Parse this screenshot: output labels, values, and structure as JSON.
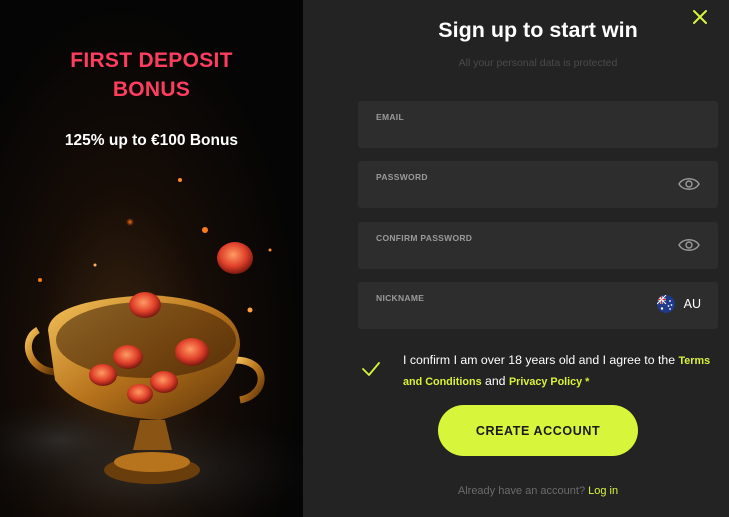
{
  "promo": {
    "title_line1": "FIRST DEPOSIT",
    "title_line2": "BONUS",
    "subtitle": "125% up to €100 Bonus"
  },
  "form": {
    "title": "Sign up to start win",
    "subtitle": "All your personal data is protected",
    "fields": {
      "email": {
        "label": "EMAIL",
        "value": ""
      },
      "password": {
        "label": "PASSWORD",
        "value": ""
      },
      "confirm_password": {
        "label": "CONFIRM PASSWORD",
        "value": ""
      },
      "nickname": {
        "label": "NICKNAME",
        "value": "",
        "country_code": "AU"
      }
    },
    "consent": {
      "text_prefix": "I confirm I am over 18 years old and I agree to the",
      "terms_link": "Terms and Conditions",
      "and": "and",
      "privacy_link": "Privacy Policy *",
      "checked": true
    },
    "submit_label": "CREATE ACCOUNT",
    "login_prompt": "Already have an account?",
    "login_link": "Log in"
  },
  "colors": {
    "accent": "#d7f53a",
    "promo_title": "#ff3d5e",
    "panel_bg": "#232323",
    "field_bg": "#2d2d2d"
  },
  "icons": {
    "close": "close-icon",
    "eye": "eye-icon",
    "check": "check-icon",
    "flag": "australia-flag-icon"
  }
}
